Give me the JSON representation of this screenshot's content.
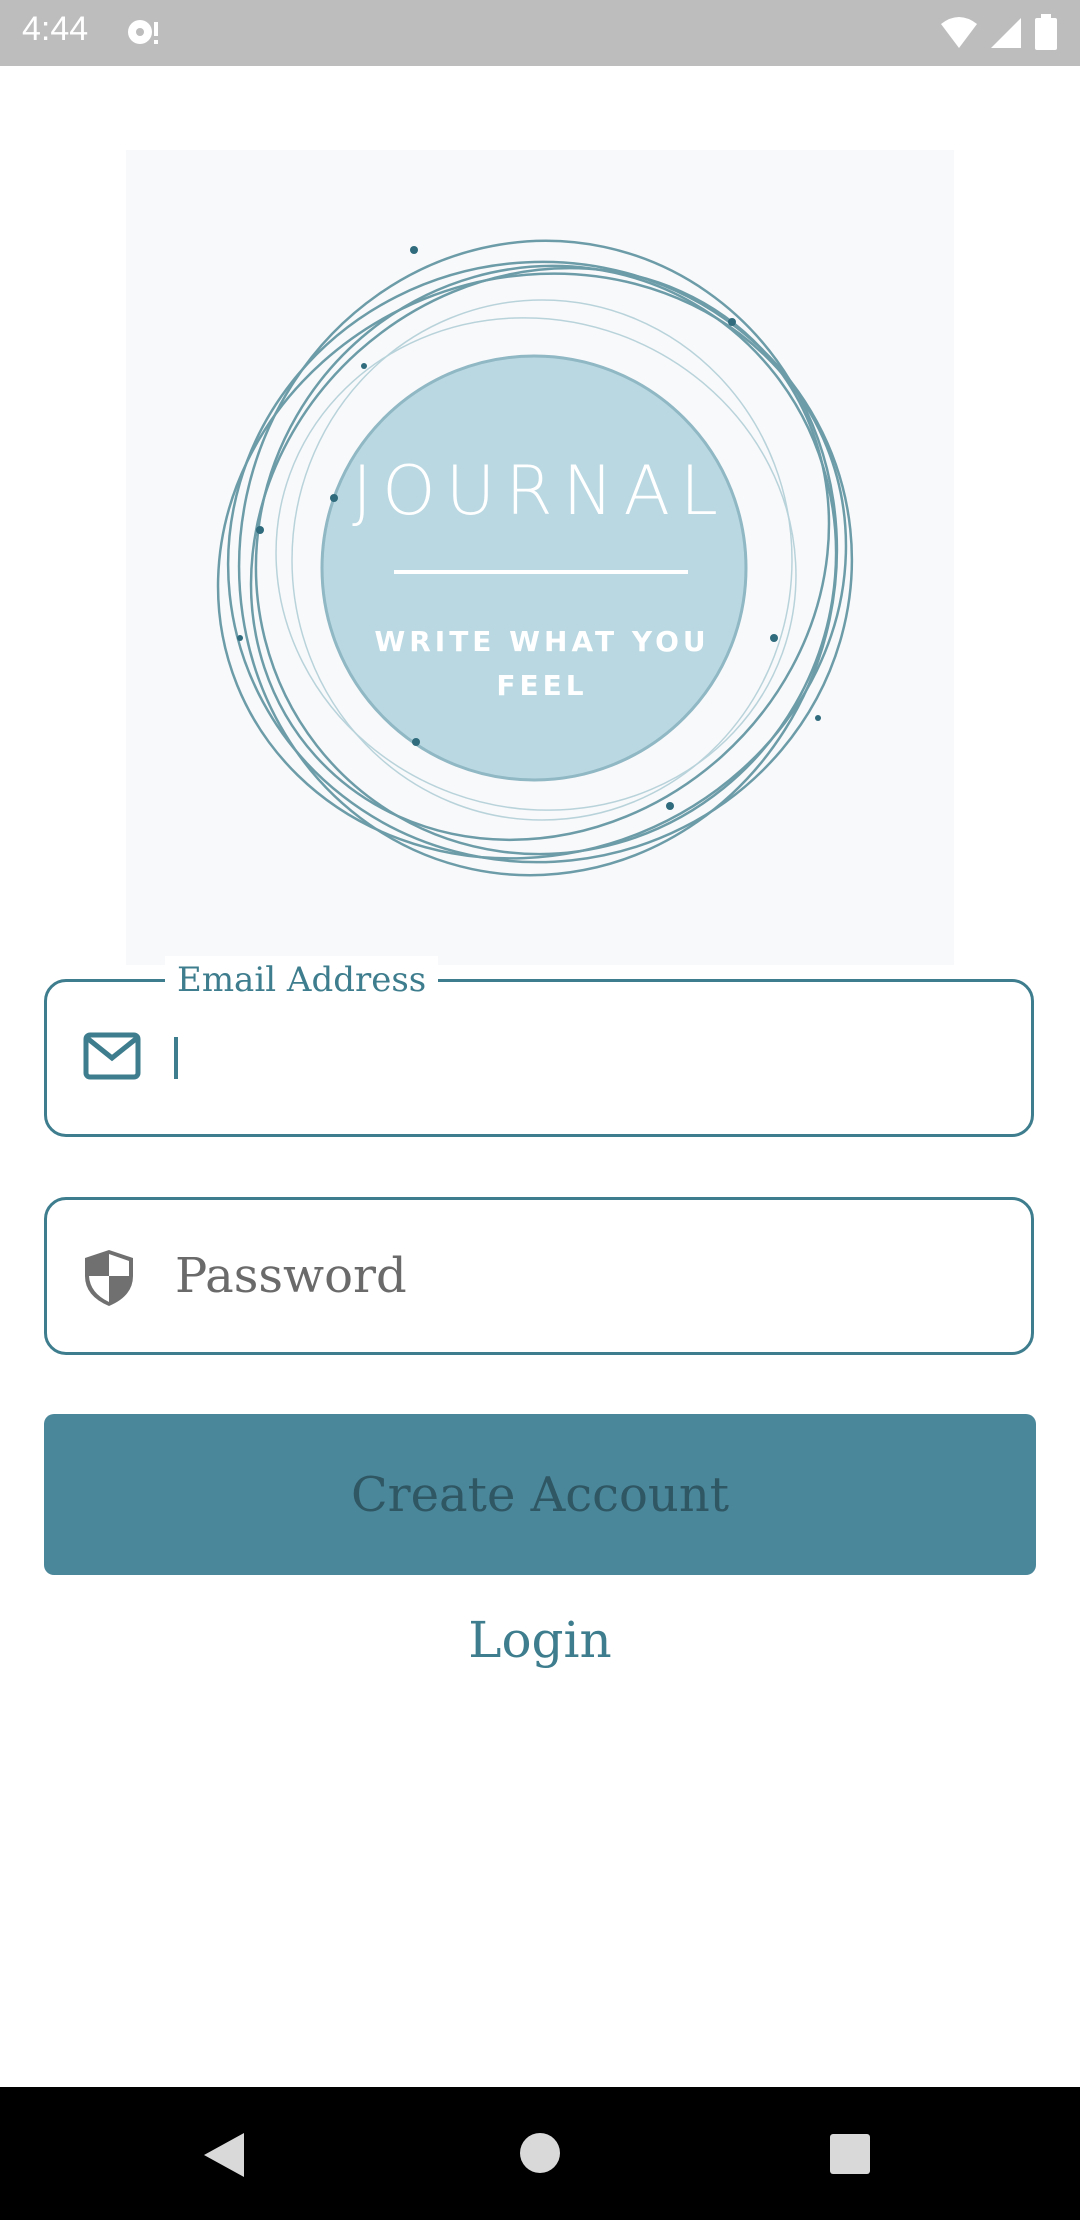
{
  "status_bar": {
    "time": "4:44"
  },
  "logo": {
    "title": "JOURNAL",
    "tagline_line1": "WRITE WHAT YOU",
    "tagline_line2": "FEEL",
    "colors": {
      "circle": "#b9d8e2",
      "ring": "#3e7d8d"
    }
  },
  "form": {
    "email": {
      "label": "Email Address",
      "value": "",
      "icon": "mail-icon"
    },
    "password": {
      "placeholder": "Password",
      "value": "",
      "icon": "shield-icon"
    },
    "create_button": "Create Account",
    "login_link": "Login"
  },
  "colors": {
    "accent": "#3e7d8d",
    "button": "#4a879b",
    "status_bar": "#bdbdbd"
  }
}
